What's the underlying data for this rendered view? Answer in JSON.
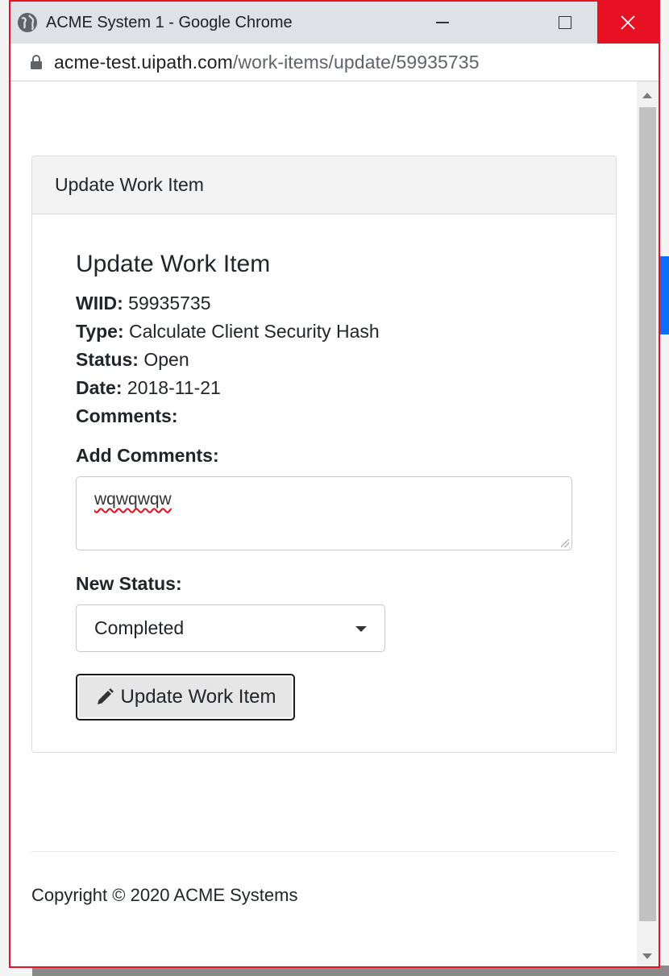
{
  "browser": {
    "window_title": "ACME System 1 - Google Chrome",
    "url_host": "acme-test.uipath.com",
    "url_path": "/work-items/update/59935735"
  },
  "card": {
    "header": "Update Work Item",
    "heading": "Update Work Item",
    "fields": [
      {
        "label": "WIID:",
        "value": "59935735"
      },
      {
        "label": "Type:",
        "value": "Calculate Client Security Hash"
      },
      {
        "label": "Status:",
        "value": "Open"
      },
      {
        "label": "Date:",
        "value": "2018-11-21"
      },
      {
        "label": "Comments:",
        "value": ""
      }
    ],
    "add_comments_label": "Add Comments:",
    "comment_value": "wqwqwqw",
    "new_status_label": "New Status:",
    "new_status_value": "Completed",
    "submit_label": "Update Work Item"
  },
  "footer": {
    "copyright": "Copyright © 2020 ACME Systems"
  },
  "icons": {
    "tab_icon": "globe-icon",
    "lock": "lock-icon",
    "submit": "pencil-icon"
  },
  "colors": {
    "close_button": "#e81123",
    "window_border": "#e81123"
  }
}
